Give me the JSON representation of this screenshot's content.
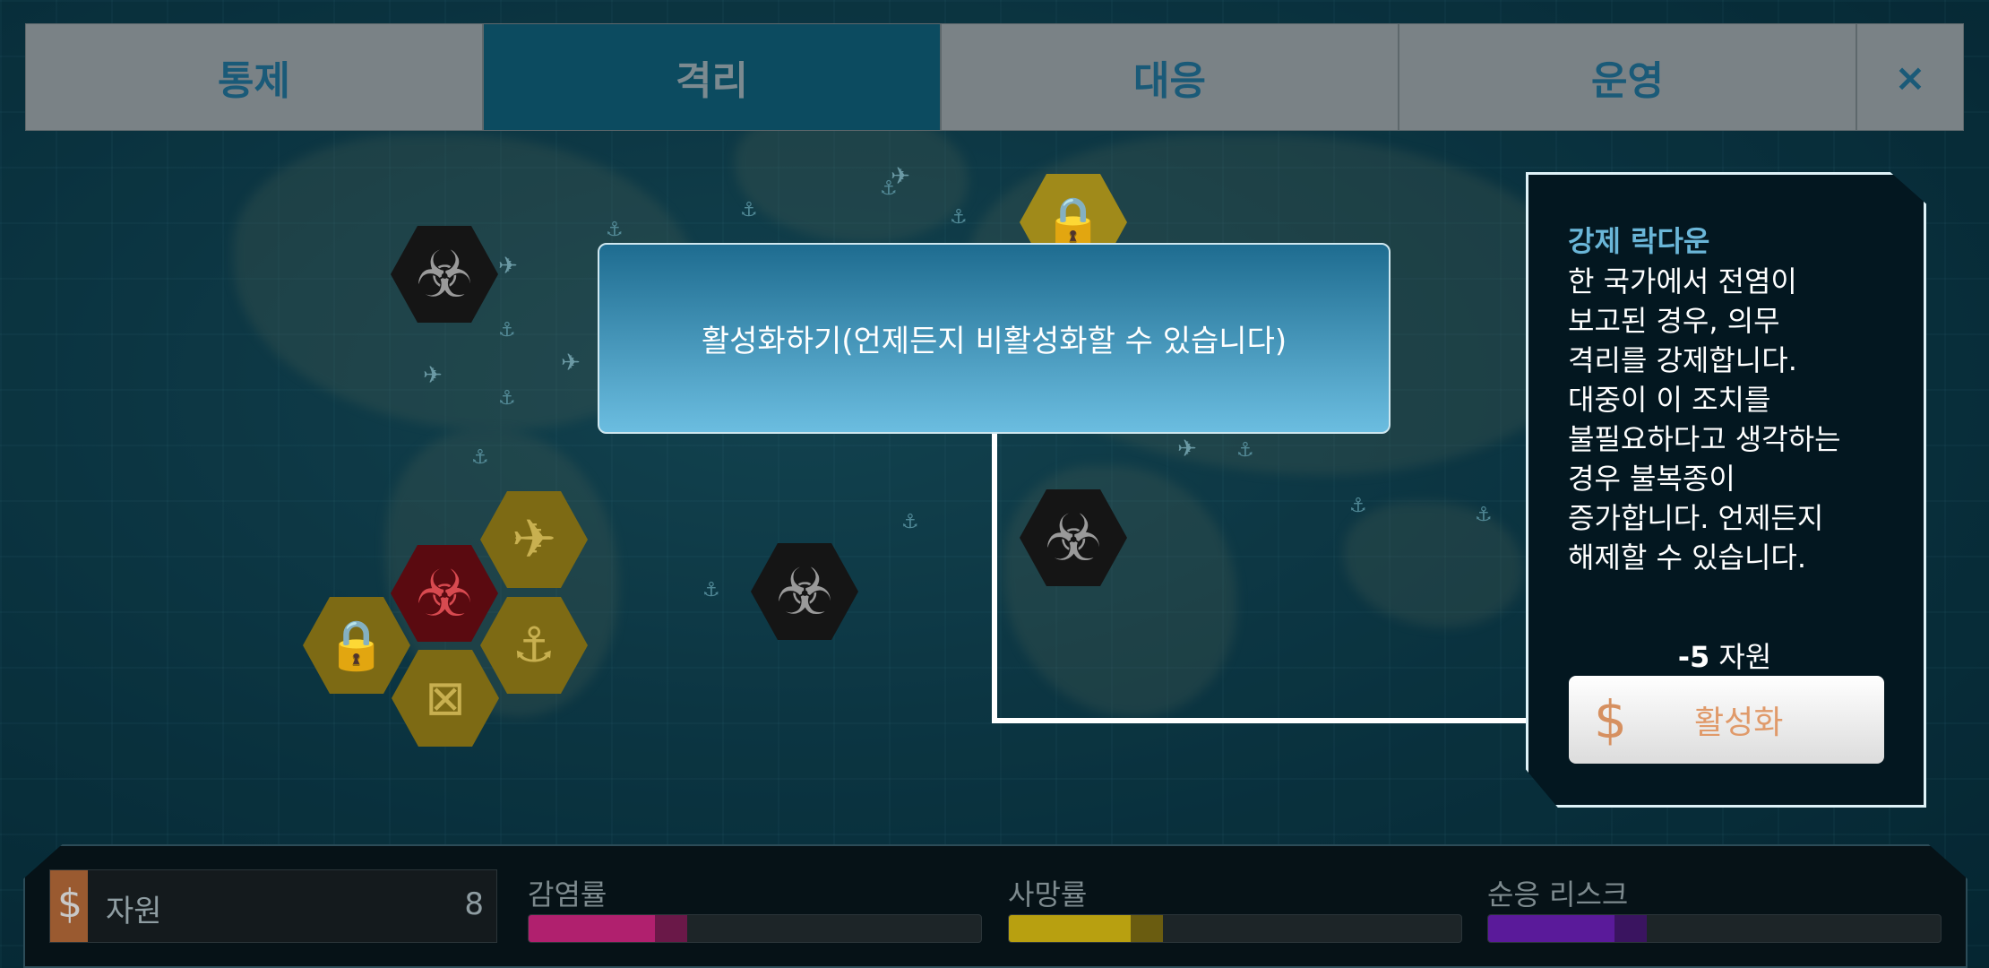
{
  "tabs": [
    {
      "label": "통제",
      "active": false
    },
    {
      "label": "격리",
      "active": true
    },
    {
      "label": "대응",
      "active": false
    },
    {
      "label": "운영",
      "active": false
    }
  ],
  "close_label": "×",
  "dialog": {
    "text": "활성화하기(언제든지 비활성화할 수 있습니다)"
  },
  "panel": {
    "title": "강제 락다운",
    "description": "한 국가에서 전염이\n보고된 경우, 의무\n격리를 강제합니다.\n대중이 이 조치를\n불필요하다고 생각하는\n경우 불복종이\n증가합니다. 언제든지\n해제할 수 있습니다.",
    "cost_amount": "-5",
    "cost_unit": " 자원",
    "button_icon": "$",
    "button_label": "활성화"
  },
  "resources": {
    "icon": "$",
    "label": "자원",
    "value": "8"
  },
  "stats": [
    {
      "label": "감염률",
      "level": 0.28,
      "color": "#b0206e",
      "trail_color": "#6a1848"
    },
    {
      "label": "사망률",
      "level": 0.27,
      "color": "#b8a010",
      "trail_color": "#6a5c10"
    },
    {
      "label": "순응 리스크",
      "level": 0.28,
      "color": "#5a1a9a",
      "trail_color": "#3a1460"
    }
  ],
  "map_icons": {
    "biohazard": "☣",
    "lock": "🔒",
    "anchor": "⚓",
    "plane": "✈"
  },
  "colors": {
    "tab_active": "#0c4b60",
    "tab_inactive": "#7a8286",
    "tab_text": "#1a5a78",
    "dialog_top": "#1e6c90",
    "dialog_bottom": "#6bbde0",
    "panel_title": "#6ab6d8",
    "button_text": "#e09a6a"
  }
}
